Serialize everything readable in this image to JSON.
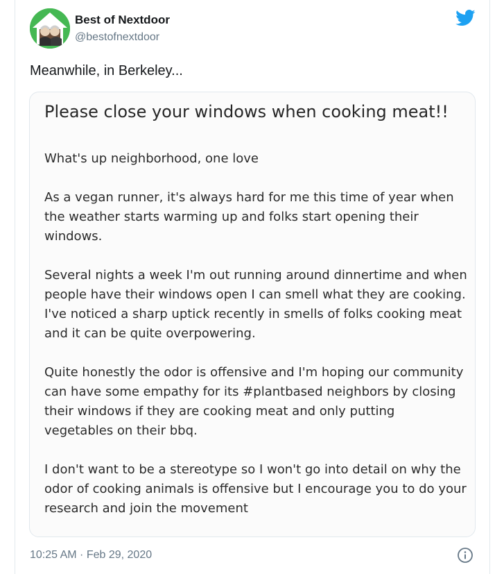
{
  "author": {
    "name": "Best of Nextdoor",
    "handle": "@bestofnextdoor"
  },
  "tweet_text": "Meanwhile, in Berkeley...",
  "card": {
    "title": "Please close your windows when cooking meat!!",
    "paragraphs": [
      "What's up neighborhood, one love",
      "As a vegan runner, it's always hard for me this time of year when the weather starts warming up and folks start opening their windows.",
      "Several nights a week I'm out running around dinnertime and when people have their windows open I can smell what they are cooking. I've noticed a sharp uptick recently in smells of folks cooking meat and it can be quite overpowering.",
      "Quite honestly the odor is offensive and I'm hoping our community can have some empathy for its #plantbased neighbors by closing their windows if they are cooking meat and only putting vegetables on their bbq.",
      "I don't want to be a stereotype so I won't go into detail on why the odor of cooking animals is offensive but I encourage you to do your research and join the movement"
    ]
  },
  "timestamp": "10:25 AM · Feb 29, 2020",
  "icons": {
    "platform": "twitter-bird-icon",
    "info": "info-icon"
  },
  "colors": {
    "twitter_blue": "#1da1f2",
    "avatar_green": "#45b853",
    "secondary_text": "#657786"
  }
}
